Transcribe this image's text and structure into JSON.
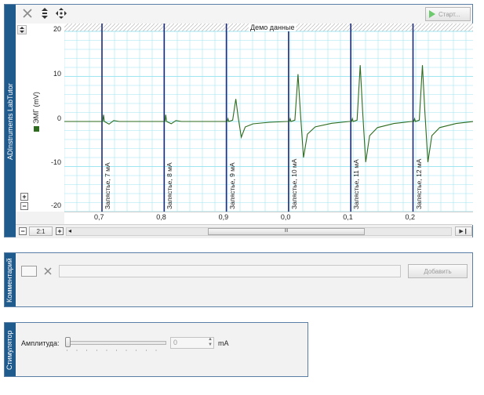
{
  "app": {
    "sidebar_title": "ADInstruments LabTutor",
    "start_label": "Старт..."
  },
  "chart": {
    "demo_label": "Демо данные",
    "channel_label": "ЭМГ (mV)",
    "scale_label": "2:1",
    "trace_color": "#2e6b1e",
    "marker_color": "#1c2a7a",
    "grid_color": "#9fe6f2",
    "y_ticks": [
      "20",
      "10",
      "0",
      "-10",
      "-20"
    ],
    "x_ticks": [
      "0,7",
      "0,8",
      "0,9",
      "0,0",
      "0,1",
      "0,2"
    ],
    "comments": [
      "Запястье, 7 мА",
      "Запястье, 8 мА",
      "Запястье, 9 мА",
      "Запястье, 10 мА",
      "Запястье, 11 мА",
      "Запястье, 12 мА"
    ],
    "scroll_glyph": "III"
  },
  "chart_data": {
    "type": "line",
    "ylabel": "ЭМГ (mV)",
    "ylim": [
      -20,
      20
    ],
    "y_ticks": [
      20,
      10,
      0,
      -10,
      -20
    ],
    "segments": [
      {
        "comment": "Запястье, 7 мА",
        "peak_pos": 0.5,
        "peak_neg": -0.6
      },
      {
        "comment": "Запястье, 8 мА",
        "peak_pos": 0.5,
        "peak_neg": -0.5
      },
      {
        "comment": "Запястье, 9 мА",
        "peak_pos": 5,
        "peak_neg": -3.5
      },
      {
        "comment": "Запястье, 10 мА",
        "peak_pos": 10.5,
        "peak_neg": -8
      },
      {
        "comment": "Запястье, 11 мА",
        "peak_pos": 12.5,
        "peak_neg": -9
      },
      {
        "comment": "Запястье, 12 мА",
        "peak_pos": 12.5,
        "peak_neg": -9
      }
    ]
  },
  "comment_panel": {
    "title": "Комментарий",
    "add_label": "Добавить"
  },
  "stimulator": {
    "title": "Стимулятор",
    "amplitude_label": "Амплитуда:",
    "amplitude_value": "0",
    "unit": "mA"
  }
}
